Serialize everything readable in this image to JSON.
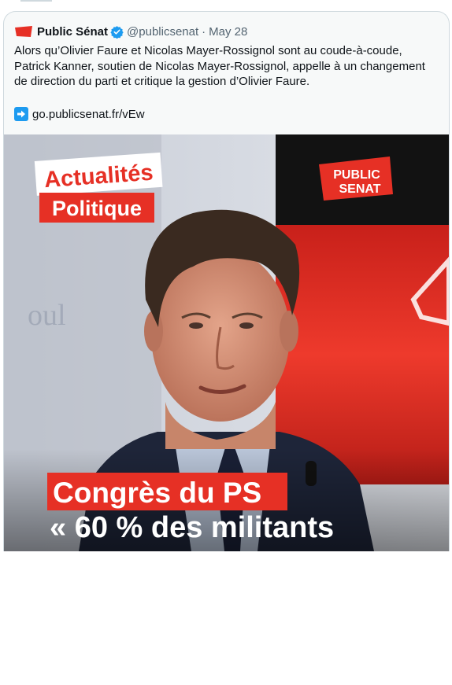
{
  "tweet": {
    "author_name": "Public Sénat",
    "handle": "@publicsenat",
    "separator": "·",
    "date": "May 28",
    "text": "Alors qu’Olivier Faure et Nicolas Mayer-Rossignol sont au coude-à-coude, Patrick Kanner, soutien de Nicolas Mayer-Rossignol, appelle à un changement de direction du parti et critique la gestion d’Olivier Faure.",
    "link_text": "go.publicsenat.fr/vEw",
    "logo_text": "PUBLIC SENAT"
  },
  "media": {
    "tag_top": "Actualités",
    "tag_bottom": "Politique",
    "logo_line1": "PUBLIC",
    "logo_line2": "SENAT",
    "headline": "Congrès du PS",
    "quote": "« 60 % des militants",
    "accent_color": "#e63025"
  },
  "colors": {
    "text": "#0f1419",
    "secondary": "#536471",
    "verified": "#1d9bf0",
    "card_bg": "#f7f9f9",
    "border": "#cfd9de"
  }
}
